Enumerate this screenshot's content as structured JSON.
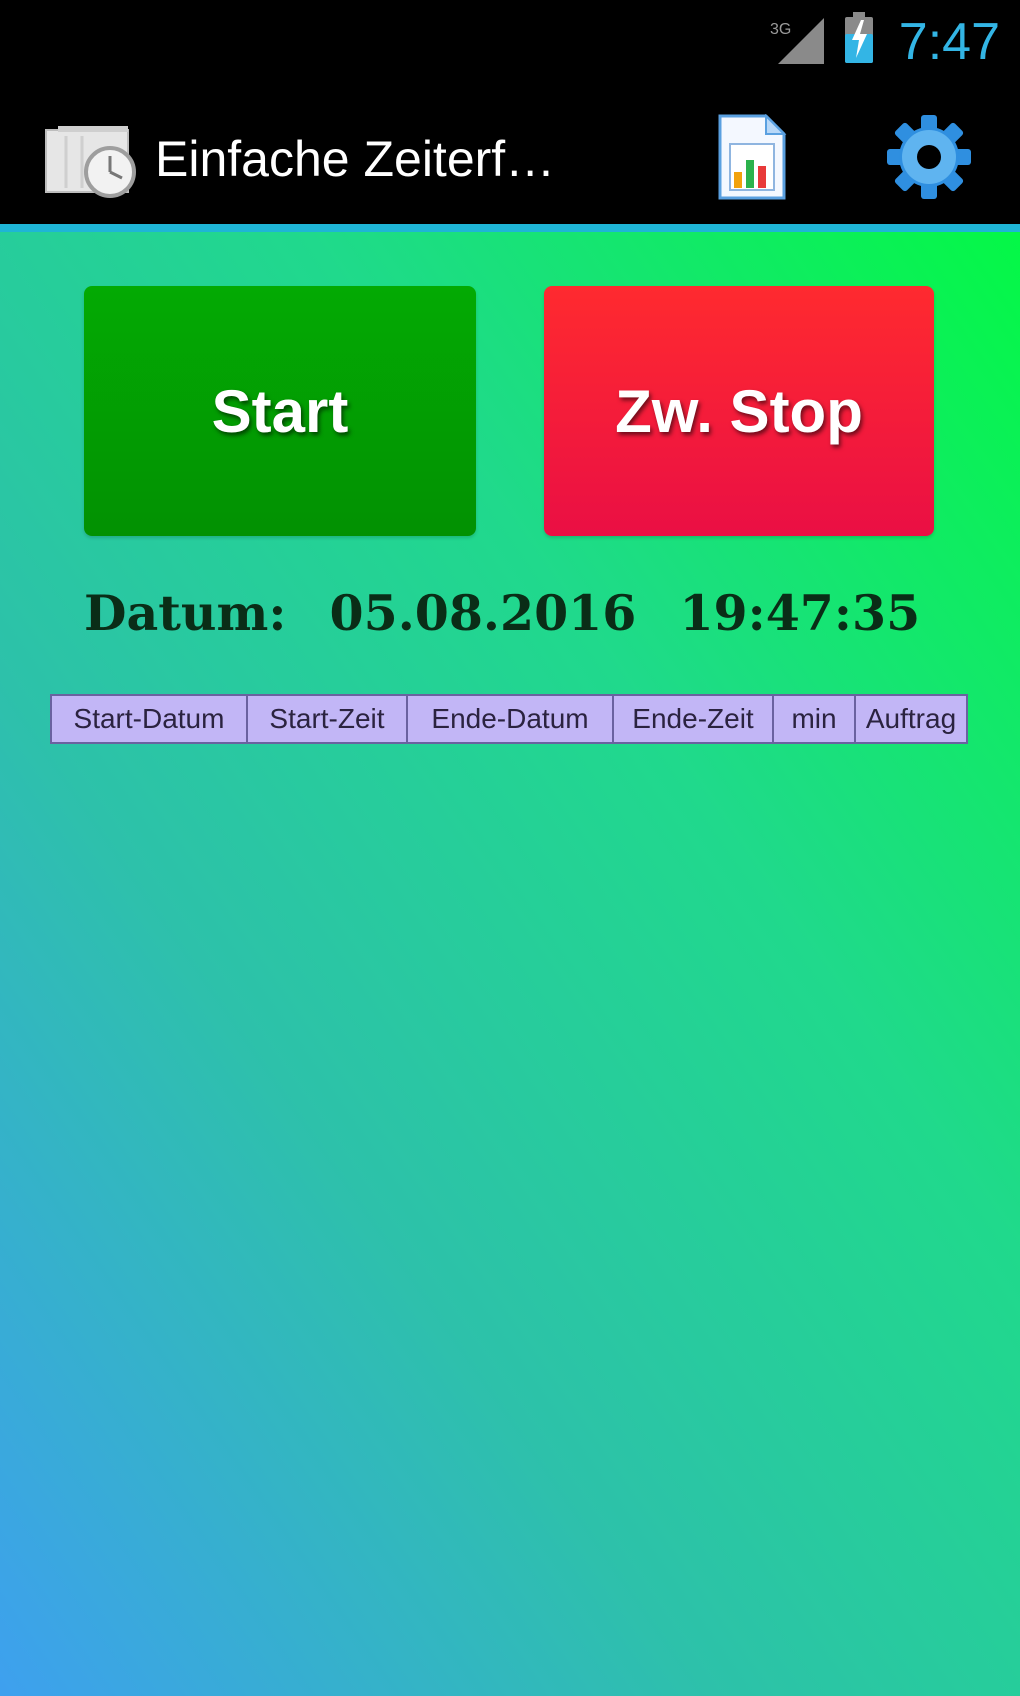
{
  "status_bar": {
    "network_label": "3G",
    "time": "7:47",
    "icons": [
      "signal-3g-icon",
      "battery-charging-icon"
    ],
    "time_color": "#33b5e5"
  },
  "action_bar": {
    "title": "Einfache Zeiterf…",
    "icons": [
      "app-clock-icon",
      "report-document-icon",
      "settings-gear-icon"
    ]
  },
  "main": {
    "start_button_label": "Start",
    "stop_button_label": "Zw. Stop",
    "date_label": "Datum:",
    "date": "05.08.2016",
    "time": "19:47:35",
    "table_headers": [
      "Start-Datum",
      "Start-Zeit",
      "Ende-Datum",
      "Ende-Zeit",
      "min",
      "Auftrag"
    ]
  },
  "colors": {
    "start_button": "#029e02",
    "stop_button": "#f71a3c",
    "table_header_bg": "#c2b6f6",
    "accent_line": "#1fb5d6"
  }
}
